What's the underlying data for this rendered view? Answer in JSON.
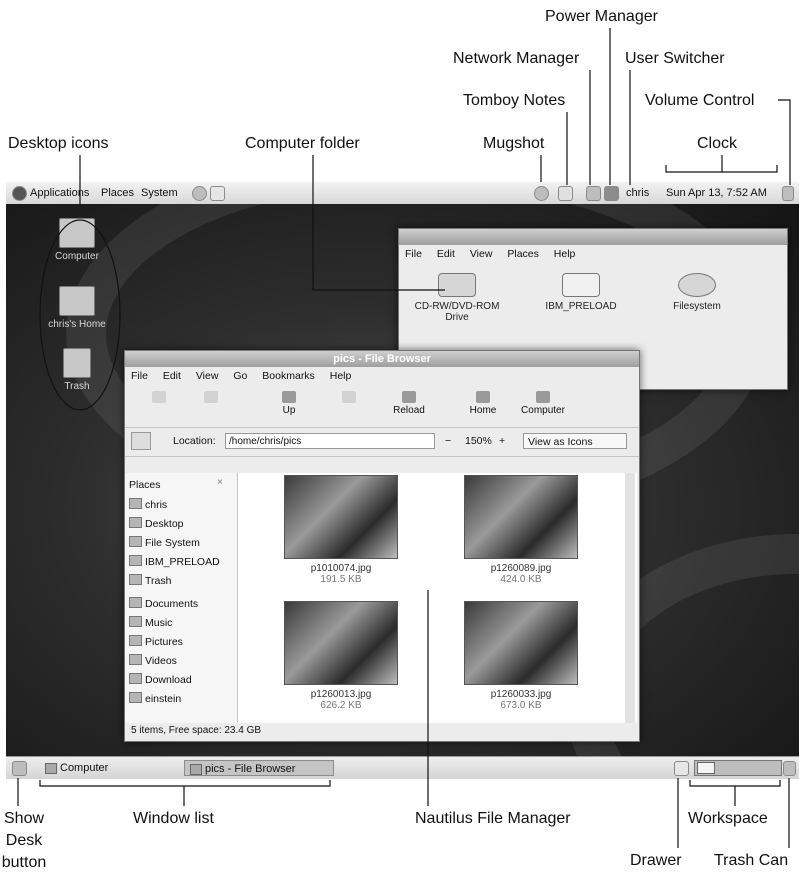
{
  "callouts": {
    "power_manager": "Power Manager",
    "network_manager": "Network Manager",
    "user_switcher": "User Switcher",
    "tomboy_notes": "Tomboy Notes",
    "volume_control": "Volume Control",
    "desktop_icons": "Desktop icons",
    "computer_folder": "Computer folder",
    "mugshot": "Mugshot",
    "clock": "Clock",
    "show_desk_button_1": "Show",
    "show_desk_button_2": "Desk",
    "show_desk_button_3": "button",
    "window_list": "Window list",
    "nautilus": "Nautilus File Manager",
    "workspace": "Workspace",
    "drawer": "Drawer",
    "trash_can": "Trash Can"
  },
  "top_panel": {
    "applications": "Applications",
    "places": "Places",
    "system": "System",
    "user": "chris",
    "clock": "Sun Apr 13,  7:52 AM"
  },
  "desktop_icons": {
    "computer": "Computer",
    "home": "chris's Home",
    "trash": "Trash"
  },
  "computer_window": {
    "menu": [
      "File",
      "Edit",
      "View",
      "Places",
      "Help"
    ],
    "items": [
      "CD-RW/DVD-ROM Drive",
      "IBM_PRELOAD",
      "Filesystem"
    ]
  },
  "browser": {
    "title": "pics - File Browser",
    "menu": [
      "File",
      "Edit",
      "View",
      "Go",
      "Bookmarks",
      "Help"
    ],
    "toolbar": {
      "up": "Up",
      "reload": "Reload",
      "home": "Home",
      "computer": "Computer"
    },
    "location_label": "Location:",
    "location_value": "/home/chris/pics",
    "zoom": "150%",
    "view_mode": "View as Icons",
    "sidebar_title": "Places",
    "sidebar": [
      "chris",
      "Desktop",
      "File System",
      "IBM_PRELOAD",
      "Trash",
      "Documents",
      "Music",
      "Pictures",
      "Videos",
      "Download",
      "einstein"
    ],
    "files": [
      {
        "name": "p1010074.jpg",
        "size": "191.5 KB"
      },
      {
        "name": "p1260089.jpg",
        "size": "424.0 KB"
      },
      {
        "name": "p1260013.jpg",
        "size": "626.2 KB"
      },
      {
        "name": "p1260033.jpg",
        "size": "673.0 KB"
      }
    ],
    "status": "5 items, Free space: 23.4 GB"
  },
  "bottom_panel": {
    "task_computer": "Computer",
    "task_browser": "pics - File Browser"
  }
}
